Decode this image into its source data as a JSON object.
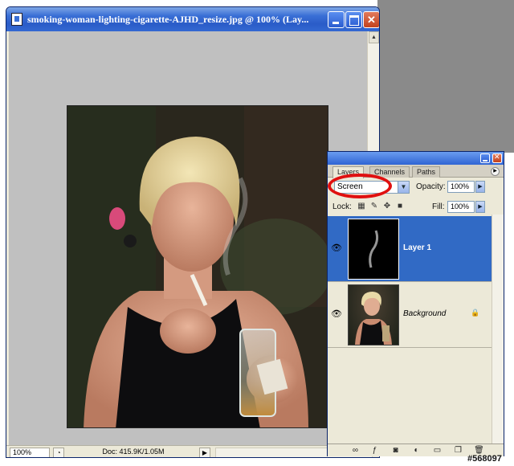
{
  "document_window": {
    "title": "smoking-woman-lighting-cigarette-AJHD_resize.jpg @ 100% (Lay...",
    "zoom_level": "100%",
    "doc_info": "Doc: 415.9K/1.05M"
  },
  "layers_panel": {
    "tabs": [
      "Layers",
      "Channels",
      "Paths"
    ],
    "blend_mode": "Screen",
    "opacity_label": "Opacity:",
    "opacity_value": "100%",
    "lock_label": "Lock:",
    "fill_label": "Fill:",
    "fill_value": "100%",
    "layers": [
      {
        "name": "Layer 1",
        "selected": true,
        "visible": true
      },
      {
        "name": "Background",
        "selected": false,
        "visible": true,
        "locked": true
      }
    ]
  },
  "watermark": "#568097",
  "icons": [
    "document-icon",
    "minimize-icon",
    "maximize-icon",
    "close-icon",
    "eye-icon",
    "lock-icon",
    "brush-icon",
    "move-icon",
    "chain-icon",
    "fx-icon",
    "mask-icon",
    "adjustment-icon",
    "folder-icon",
    "new-layer-icon",
    "trash-icon"
  ],
  "colors": {
    "selection": "#316ac5",
    "annotation_ring": "#e01010",
    "titlebar": "#2a5cc8"
  }
}
